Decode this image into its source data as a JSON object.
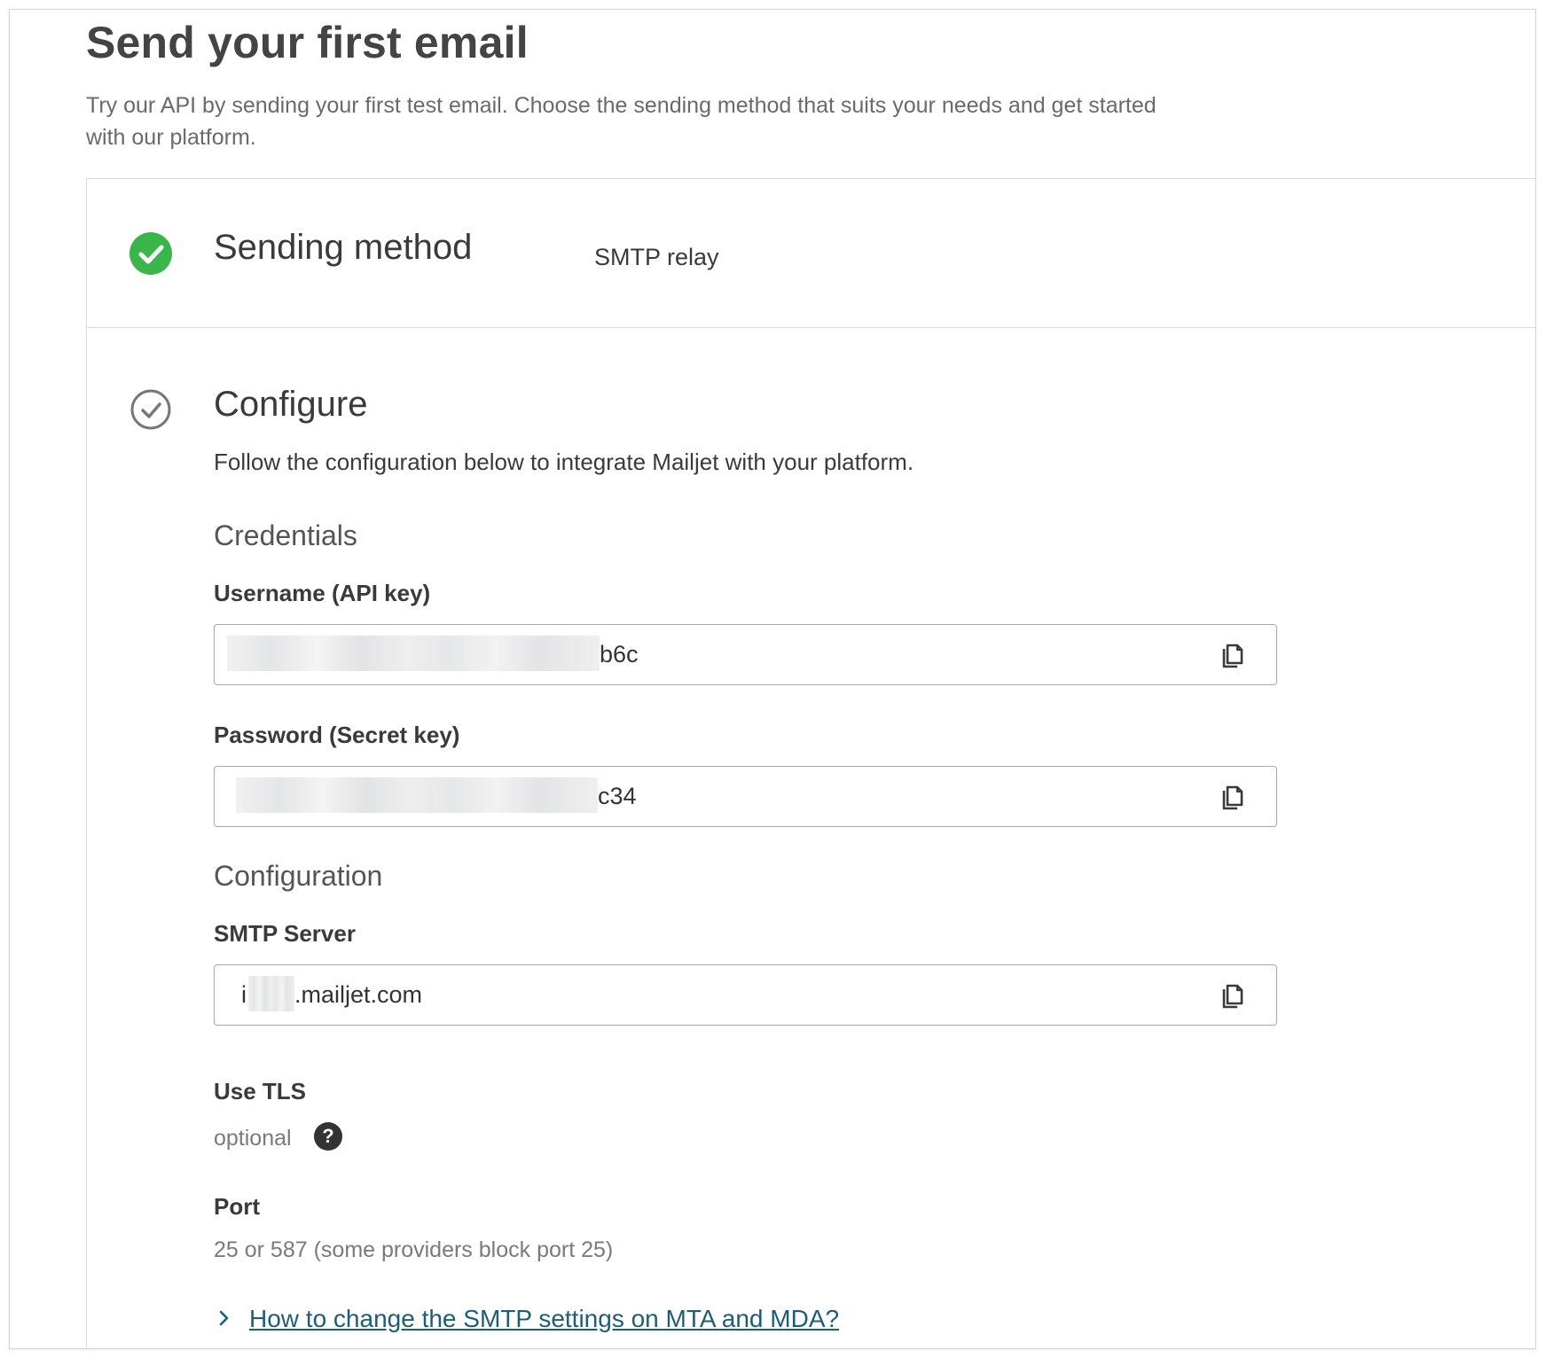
{
  "header": {
    "title": "Send your first email",
    "description": "Try our API by sending your first test email. Choose the sending method that suits your needs and get started with our platform."
  },
  "steps": {
    "sending_method": {
      "title": "Sending method",
      "value": "SMTP relay"
    },
    "configure": {
      "title": "Configure",
      "description": "Follow the configuration below to integrate Mailjet with your platform."
    }
  },
  "credentials": {
    "heading": "Credentials",
    "username_label": "Username (API key)",
    "username_visible_suffix": "b6c",
    "password_label": "Password (Secret key)",
    "password_visible_suffix": "c34"
  },
  "configuration": {
    "heading": "Configuration",
    "smtp_label": "SMTP Server",
    "smtp_prefix": "i",
    "smtp_suffix": ".mailjet.com",
    "tls_label": "Use TLS",
    "tls_value": "optional",
    "help_glyph": "?",
    "port_label": "Port",
    "port_value": "25 or 587 (some providers block port 25)"
  },
  "faq": {
    "link_text": "How to change the SMTP settings on MTA and MDA?"
  },
  "colors": {
    "success_green": "#3ab54a",
    "link_blue": "#1d5d7a",
    "text_dark": "#3a3a3a"
  },
  "icons": [
    "check-circle-filled-icon",
    "check-circle-outline-icon",
    "copy-icon",
    "help-icon",
    "chevron-right-icon"
  ]
}
